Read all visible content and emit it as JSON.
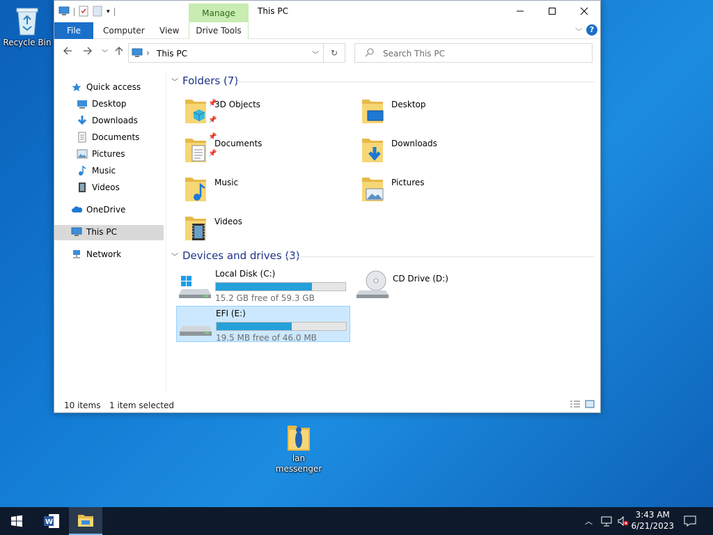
{
  "desktop": {
    "recycle_bin": "Recycle Bin",
    "lan_messenger": "lan messenger"
  },
  "window": {
    "title": "This PC",
    "manage_tab": "Manage",
    "ribbon_tabs": [
      "File",
      "Computer",
      "View",
      "Drive Tools"
    ]
  },
  "address": {
    "path": "This PC",
    "search_placeholder": "Search This PC"
  },
  "nav": {
    "quick_access": "Quick access",
    "items": [
      "Desktop",
      "Downloads",
      "Documents",
      "Pictures",
      "Music",
      "Videos"
    ],
    "onedrive": "OneDrive",
    "this_pc": "This PC",
    "network": "Network"
  },
  "content": {
    "folders_header": "Folders (7)",
    "folders": [
      "3D Objects",
      "Desktop",
      "Documents",
      "Downloads",
      "Music",
      "Pictures",
      "Videos"
    ],
    "devices_header": "Devices and drives (3)",
    "drives": [
      {
        "name": "Local Disk (C:)",
        "free": "15.2 GB free of 59.3 GB",
        "used_fraction": 0.74
      },
      {
        "name": "CD Drive (D:)"
      },
      {
        "name": "EFI (E:)",
        "free": "19.5 MB free of 46.0 MB",
        "used_fraction": 0.58
      }
    ]
  },
  "status": {
    "items": "10 items",
    "selected": "1 item selected"
  },
  "taskbar": {
    "time": "3:43 AM",
    "date": "6/21/2023"
  }
}
